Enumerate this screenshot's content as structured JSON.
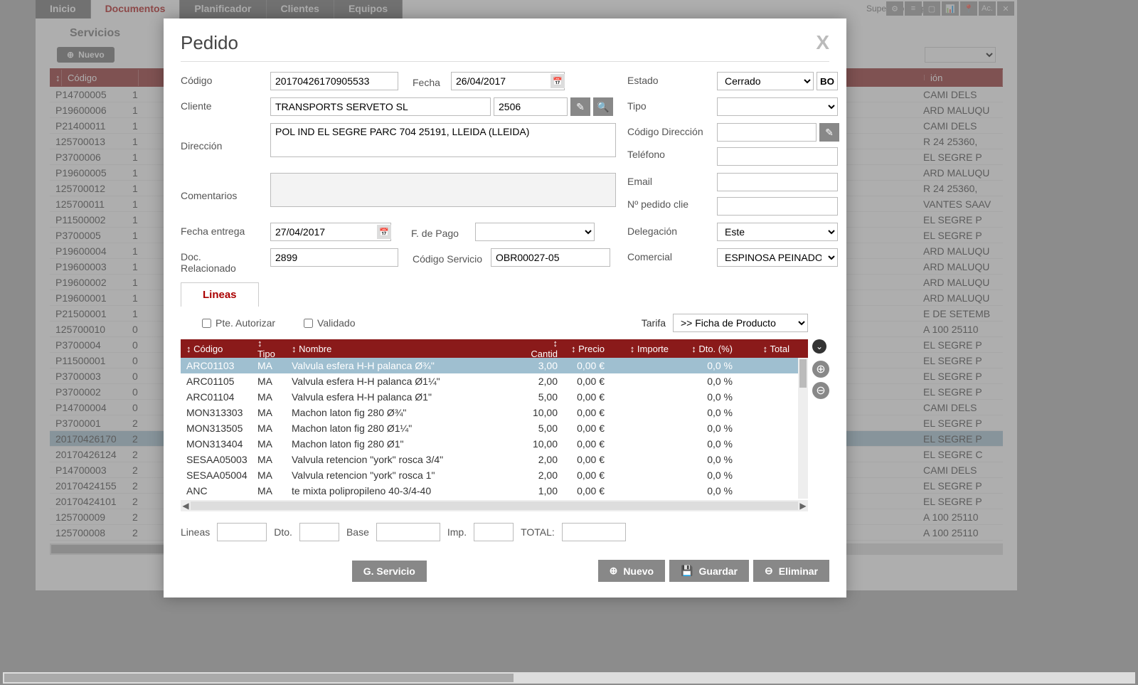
{
  "topbar": {
    "tabs": [
      "Inicio",
      "Documentos",
      "Planificador",
      "Clientes",
      "Equipos"
    ],
    "active_tab": "Documentos",
    "supervisor": "Supervisor (sup)",
    "icons": [
      "⚙",
      "≡",
      "▢",
      "📊",
      "📍",
      "Ac.",
      "✕"
    ]
  },
  "subtab": "Servicios",
  "toolbar": {
    "nuevo": "Nuevo"
  },
  "bg_table": {
    "header": "Código",
    "header2": "ión",
    "rows": [
      {
        "c": "P14700005",
        "n": "1",
        "d": "CAMI DELS"
      },
      {
        "c": "P19600006",
        "n": "1",
        "d": "ARD MALUQU"
      },
      {
        "c": "P21400011",
        "n": "1",
        "d": "CAMI DELS"
      },
      {
        "c": "125700013",
        "n": "1",
        "d": "R 24 25360,"
      },
      {
        "c": "P3700006",
        "n": "1",
        "d": "EL SEGRE P"
      },
      {
        "c": "P19600005",
        "n": "1",
        "d": "ARD MALUQU"
      },
      {
        "c": "125700012",
        "n": "1",
        "d": "R 24 25360,"
      },
      {
        "c": "125700011",
        "n": "1",
        "d": "VANTES SAAV"
      },
      {
        "c": "P11500002",
        "n": "1",
        "d": "EL SEGRE P"
      },
      {
        "c": "P3700005",
        "n": "1",
        "d": "EL SEGRE P"
      },
      {
        "c": "P19600004",
        "n": "1",
        "d": "ARD MALUQU"
      },
      {
        "c": "P19600003",
        "n": "1",
        "d": "ARD MALUQU"
      },
      {
        "c": "P19600002",
        "n": "1",
        "d": "ARD MALUQU"
      },
      {
        "c": "P19600001",
        "n": "1",
        "d": "ARD MALUQU"
      },
      {
        "c": "P21500001",
        "n": "1",
        "d": "E DE SETEMB"
      },
      {
        "c": "125700010",
        "n": "0",
        "d": "A 100 25110"
      },
      {
        "c": "P3700004",
        "n": "0",
        "d": "EL SEGRE P"
      },
      {
        "c": "P11500001",
        "n": "0",
        "d": "EL SEGRE P"
      },
      {
        "c": "P3700003",
        "n": "0",
        "d": "EL SEGRE P"
      },
      {
        "c": "P3700002",
        "n": "0",
        "d": "EL SEGRE P"
      },
      {
        "c": "P14700004",
        "n": "0",
        "d": "CAMI DELS"
      },
      {
        "c": "P3700001",
        "n": "2",
        "d": "EL SEGRE P"
      },
      {
        "c": "20170426170",
        "n": "2",
        "d": "EL SEGRE P",
        "sel": true
      },
      {
        "c": "20170426124",
        "n": "2",
        "d": "EL SEGRE C"
      },
      {
        "c": "P14700003",
        "n": "2",
        "d": "CAMI DELS"
      },
      {
        "c": "20170424155",
        "n": "2",
        "d": "EL SEGRE P"
      },
      {
        "c": "20170424101",
        "n": "2",
        "d": "EL SEGRE P"
      },
      {
        "c": "125700009",
        "n": "2",
        "d": "A 100 25110"
      },
      {
        "c": "125700008",
        "n": "2",
        "d": "A 100 25110"
      }
    ]
  },
  "dialog": {
    "title": "Pedido",
    "labels": {
      "codigo": "Código",
      "fecha": "Fecha",
      "estado": "Estado",
      "bo": "BO",
      "cliente": "Cliente",
      "tipo": "Tipo",
      "direccion": "Dirección",
      "codigo_dir": "Código Dirección",
      "telefono": "Teléfono",
      "comentarios": "Comentarios",
      "email": "Email",
      "pedido_cli": "Nº pedido clie",
      "fecha_entrega": "Fecha entrega",
      "fpago": "F. de Pago",
      "delegacion": "Delegación",
      "doc_rel": "Doc. Relacionado",
      "cod_serv": "Código Servicio",
      "comercial": "Comercial"
    },
    "values": {
      "codigo": "20170426170905533",
      "fecha": "26/04/2017",
      "estado": "Cerrado",
      "cliente": "TRANSPORTS SERVETO SL",
      "cliente_num": "2506",
      "direccion": "POL IND EL SEGRE PARC 704 25191, LLEIDA (LLEIDA)",
      "fecha_entrega": "27/04/2017",
      "delegacion": "Este",
      "doc_rel": "2899",
      "cod_serv": "OBR00027-05",
      "comercial": "ESPINOSA PEINADO, C"
    },
    "lineas": {
      "tab_label": "Lineas",
      "pte_autorizar": "Pte. Autorizar",
      "validado": "Validado",
      "tarifa_label": "Tarifa",
      "ficha_label": ">> Ficha de Producto",
      "headers": {
        "codigo": "Código",
        "tipo": "Tipo",
        "nombre": "Nombre",
        "cantid": "Cantid",
        "precio": "Precio",
        "importe": "Importe",
        "dto": "Dto. (%)",
        "total": "Total"
      },
      "rows": [
        {
          "codigo": "ARC01103",
          "tipo": "MA",
          "nombre": "Valvula esfera H-H palanca Ø¾\"",
          "cant": "3,00",
          "precio": "0,00 €",
          "dto": "0,0 %",
          "sel": true
        },
        {
          "codigo": "ARC01105",
          "tipo": "MA",
          "nombre": "Valvula esfera H-H palanca Ø1¼\"",
          "cant": "2,00",
          "precio": "0,00 €",
          "dto": "0,0 %"
        },
        {
          "codigo": "ARC01104",
          "tipo": "MA",
          "nombre": "Valvula esfera H-H palanca Ø1\"",
          "cant": "5,00",
          "precio": "0,00 €",
          "dto": "0,0 %"
        },
        {
          "codigo": "MON313303",
          "tipo": "MA",
          "nombre": "Machon laton fig 280 Ø¾\"",
          "cant": "10,00",
          "precio": "0,00 €",
          "dto": "0,0 %"
        },
        {
          "codigo": "MON313505",
          "tipo": "MA",
          "nombre": "Machon laton fig 280 Ø1¼\"",
          "cant": "5,00",
          "precio": "0,00 €",
          "dto": "0,0 %"
        },
        {
          "codigo": "MON313404",
          "tipo": "MA",
          "nombre": "Machon laton fig 280 Ø1\"",
          "cant": "10,00",
          "precio": "0,00 €",
          "dto": "0,0 %"
        },
        {
          "codigo": "SESAA05003",
          "tipo": "MA",
          "nombre": "Valvula retencion \"york\" rosca 3/4\"",
          "cant": "2,00",
          "precio": "0,00 €",
          "dto": "0,0 %"
        },
        {
          "codigo": "SESAA05004",
          "tipo": "MA",
          "nombre": "Valvula retencion \"york\" rosca 1\"",
          "cant": "2,00",
          "precio": "0,00 €",
          "dto": "0,0 %"
        },
        {
          "codigo": "ANC",
          "tipo": "MA",
          "nombre": "te mixta polipropileno 40-3/4-40",
          "cant": "1,00",
          "precio": "0,00 €",
          "dto": "0,0 %"
        }
      ]
    },
    "totals": {
      "lineas": "Lineas",
      "dto": "Dto.",
      "base": "Base",
      "imp": "Imp.",
      "total": "TOTAL:"
    },
    "footer": {
      "gservicio": "G. Servicio",
      "nuevo": "Nuevo",
      "guardar": "Guardar",
      "eliminar": "Eliminar"
    }
  }
}
